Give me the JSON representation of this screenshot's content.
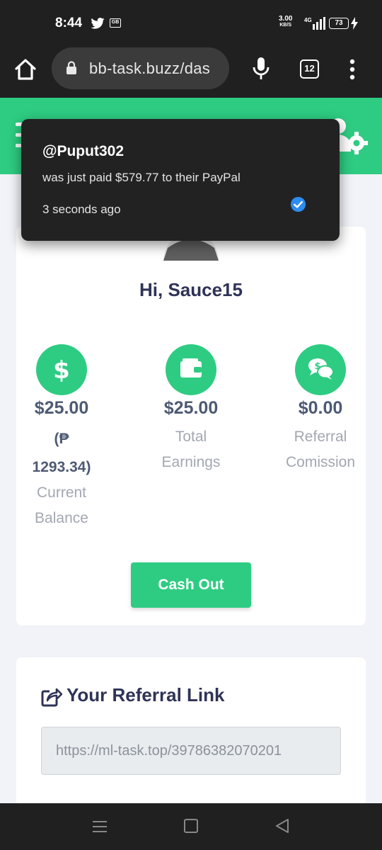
{
  "status_bar": {
    "time": "8:44",
    "net_speed_value": "3.00",
    "net_speed_unit": "KB/S",
    "network_type": "4G",
    "battery": "73",
    "gb_badge": "GB"
  },
  "browser": {
    "url": "bb-task.buzz/das",
    "tab_count": "12"
  },
  "toast": {
    "username": "@Puput302",
    "message": "was just paid $579.77 to their PayPal",
    "time": "3 seconds ago"
  },
  "profile": {
    "greeting": "Hi, Sauce15"
  },
  "stats": [
    {
      "value": "$25.00",
      "sub_1": "(₱",
      "sub_2": "1293.34)",
      "label_1": "Current",
      "label_2": "Balance",
      "icon": "dollar-icon"
    },
    {
      "value": "$25.00",
      "label_1": "Total",
      "label_2": "Earnings",
      "icon": "wallet-icon"
    },
    {
      "value": "$0.00",
      "label_1": "Referral",
      "label_2": "Comission",
      "icon": "chat-dollar-icon"
    }
  ],
  "cashout_label": "Cash Out",
  "referral": {
    "title": "Your Referral Link",
    "link": "https://ml-task.top/39786382070201"
  },
  "colors": {
    "brand_green": "#2ecc82",
    "heading": "#2f3356",
    "stat_value": "#4e5a73",
    "muted": "#a3a7b2",
    "verified_blue": "#2d8cf0"
  }
}
